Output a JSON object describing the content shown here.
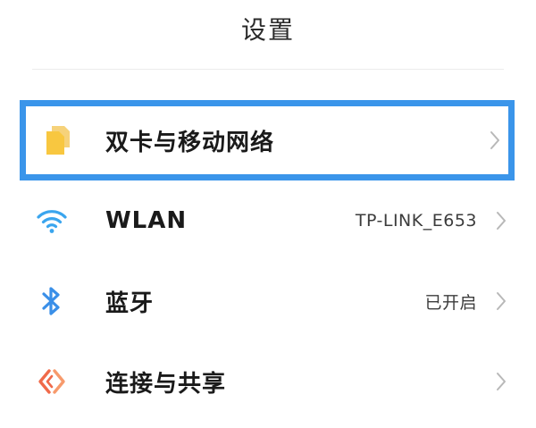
{
  "header": {
    "title": "设置"
  },
  "colors": {
    "highlight_border": "#3a95ea",
    "sim_icon": "#f8c740",
    "wifi_icon": "#3aa5ee",
    "bluetooth_icon": "#3a8fe8",
    "connection_icon": "#f06a4a",
    "chevron": "#b8b8b8"
  },
  "settings": {
    "items": [
      {
        "label": "双卡与移动网络",
        "value": "",
        "icon": "sim-card-icon"
      },
      {
        "label": "WLAN",
        "value": "TP-LINK_E653",
        "icon": "wifi-icon"
      },
      {
        "label": "蓝牙",
        "value": "已开启",
        "icon": "bluetooth-icon"
      },
      {
        "label": "连接与共享",
        "value": "",
        "icon": "connection-share-icon"
      }
    ]
  }
}
